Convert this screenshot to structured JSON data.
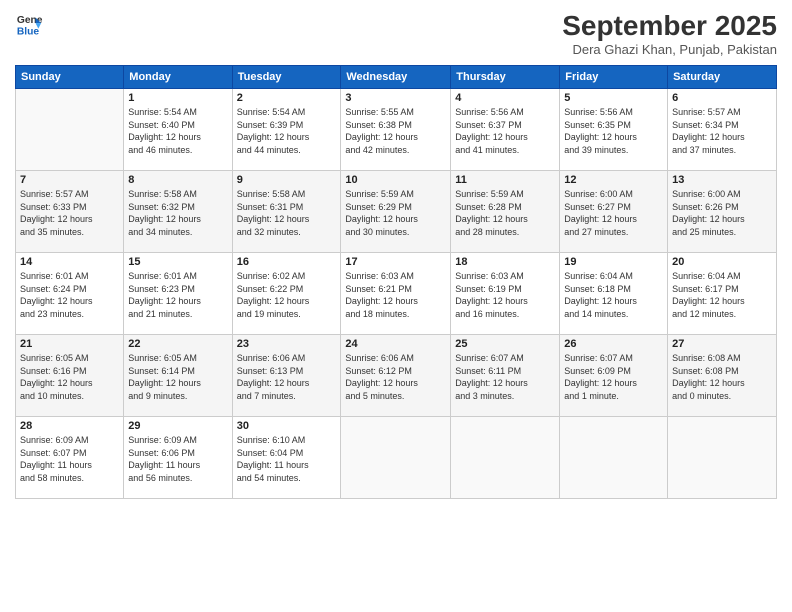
{
  "header": {
    "logo_line1": "General",
    "logo_line2": "Blue",
    "month": "September 2025",
    "location": "Dera Ghazi Khan, Punjab, Pakistan"
  },
  "weekdays": [
    "Sunday",
    "Monday",
    "Tuesday",
    "Wednesday",
    "Thursday",
    "Friday",
    "Saturday"
  ],
  "weeks": [
    [
      {
        "day": "",
        "info": ""
      },
      {
        "day": "1",
        "info": "Sunrise: 5:54 AM\nSunset: 6:40 PM\nDaylight: 12 hours\nand 46 minutes."
      },
      {
        "day": "2",
        "info": "Sunrise: 5:54 AM\nSunset: 6:39 PM\nDaylight: 12 hours\nand 44 minutes."
      },
      {
        "day": "3",
        "info": "Sunrise: 5:55 AM\nSunset: 6:38 PM\nDaylight: 12 hours\nand 42 minutes."
      },
      {
        "day": "4",
        "info": "Sunrise: 5:56 AM\nSunset: 6:37 PM\nDaylight: 12 hours\nand 41 minutes."
      },
      {
        "day": "5",
        "info": "Sunrise: 5:56 AM\nSunset: 6:35 PM\nDaylight: 12 hours\nand 39 minutes."
      },
      {
        "day": "6",
        "info": "Sunrise: 5:57 AM\nSunset: 6:34 PM\nDaylight: 12 hours\nand 37 minutes."
      }
    ],
    [
      {
        "day": "7",
        "info": "Sunrise: 5:57 AM\nSunset: 6:33 PM\nDaylight: 12 hours\nand 35 minutes."
      },
      {
        "day": "8",
        "info": "Sunrise: 5:58 AM\nSunset: 6:32 PM\nDaylight: 12 hours\nand 34 minutes."
      },
      {
        "day": "9",
        "info": "Sunrise: 5:58 AM\nSunset: 6:31 PM\nDaylight: 12 hours\nand 32 minutes."
      },
      {
        "day": "10",
        "info": "Sunrise: 5:59 AM\nSunset: 6:29 PM\nDaylight: 12 hours\nand 30 minutes."
      },
      {
        "day": "11",
        "info": "Sunrise: 5:59 AM\nSunset: 6:28 PM\nDaylight: 12 hours\nand 28 minutes."
      },
      {
        "day": "12",
        "info": "Sunrise: 6:00 AM\nSunset: 6:27 PM\nDaylight: 12 hours\nand 27 minutes."
      },
      {
        "day": "13",
        "info": "Sunrise: 6:00 AM\nSunset: 6:26 PM\nDaylight: 12 hours\nand 25 minutes."
      }
    ],
    [
      {
        "day": "14",
        "info": "Sunrise: 6:01 AM\nSunset: 6:24 PM\nDaylight: 12 hours\nand 23 minutes."
      },
      {
        "day": "15",
        "info": "Sunrise: 6:01 AM\nSunset: 6:23 PM\nDaylight: 12 hours\nand 21 minutes."
      },
      {
        "day": "16",
        "info": "Sunrise: 6:02 AM\nSunset: 6:22 PM\nDaylight: 12 hours\nand 19 minutes."
      },
      {
        "day": "17",
        "info": "Sunrise: 6:03 AM\nSunset: 6:21 PM\nDaylight: 12 hours\nand 18 minutes."
      },
      {
        "day": "18",
        "info": "Sunrise: 6:03 AM\nSunset: 6:19 PM\nDaylight: 12 hours\nand 16 minutes."
      },
      {
        "day": "19",
        "info": "Sunrise: 6:04 AM\nSunset: 6:18 PM\nDaylight: 12 hours\nand 14 minutes."
      },
      {
        "day": "20",
        "info": "Sunrise: 6:04 AM\nSunset: 6:17 PM\nDaylight: 12 hours\nand 12 minutes."
      }
    ],
    [
      {
        "day": "21",
        "info": "Sunrise: 6:05 AM\nSunset: 6:16 PM\nDaylight: 12 hours\nand 10 minutes."
      },
      {
        "day": "22",
        "info": "Sunrise: 6:05 AM\nSunset: 6:14 PM\nDaylight: 12 hours\nand 9 minutes."
      },
      {
        "day": "23",
        "info": "Sunrise: 6:06 AM\nSunset: 6:13 PM\nDaylight: 12 hours\nand 7 minutes."
      },
      {
        "day": "24",
        "info": "Sunrise: 6:06 AM\nSunset: 6:12 PM\nDaylight: 12 hours\nand 5 minutes."
      },
      {
        "day": "25",
        "info": "Sunrise: 6:07 AM\nSunset: 6:11 PM\nDaylight: 12 hours\nand 3 minutes."
      },
      {
        "day": "26",
        "info": "Sunrise: 6:07 AM\nSunset: 6:09 PM\nDaylight: 12 hours\nand 1 minute."
      },
      {
        "day": "27",
        "info": "Sunrise: 6:08 AM\nSunset: 6:08 PM\nDaylight: 12 hours\nand 0 minutes."
      }
    ],
    [
      {
        "day": "28",
        "info": "Sunrise: 6:09 AM\nSunset: 6:07 PM\nDaylight: 11 hours\nand 58 minutes."
      },
      {
        "day": "29",
        "info": "Sunrise: 6:09 AM\nSunset: 6:06 PM\nDaylight: 11 hours\nand 56 minutes."
      },
      {
        "day": "30",
        "info": "Sunrise: 6:10 AM\nSunset: 6:04 PM\nDaylight: 11 hours\nand 54 minutes."
      },
      {
        "day": "",
        "info": ""
      },
      {
        "day": "",
        "info": ""
      },
      {
        "day": "",
        "info": ""
      },
      {
        "day": "",
        "info": ""
      }
    ]
  ]
}
